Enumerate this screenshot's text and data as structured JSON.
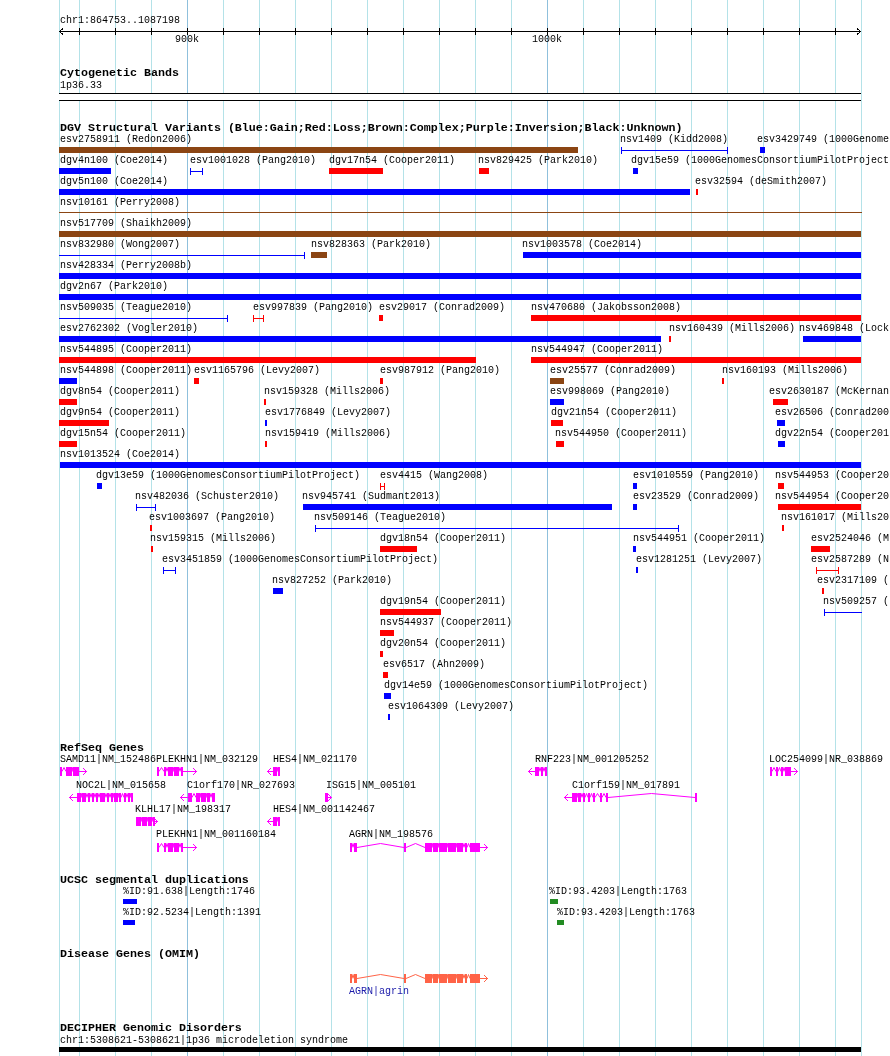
{
  "ruler": {
    "region": "chr1:864753..1087198",
    "ticks": [
      "900k",
      "1000k"
    ]
  },
  "cytogenetic_bands": {
    "title": "Cytogenetic Bands",
    "band": "1p36.33"
  },
  "dgv_variants": {
    "title": "DGV Structural Variants (Blue:Gain;Red:Loss;Brown:Complex;Purple:Inversion;Black:Unknown)",
    "features": [
      {
        "label": "esv2758911 (Redon2006)",
        "kind": "bar",
        "color": "#8b4513"
      },
      {
        "label": "nsv1409 (Kidd2008)",
        "kind": "span",
        "color": "#0000ff"
      },
      {
        "label": "esv3429749 (1000Genome",
        "kind": "bar",
        "color": "#0000ff"
      },
      {
        "label": "dgv4n100 (Coe2014)",
        "kind": "bar",
        "color": "#0000ff"
      },
      {
        "label": "esv1001028 (Pang2010)",
        "kind": "span",
        "color": "#0000ff"
      },
      {
        "label": "dgv17n54 (Cooper2011)",
        "kind": "bar",
        "color": "#ff0000"
      },
      {
        "label": "nsv829425 (Park2010)",
        "kind": "bar",
        "color": "#ff0000"
      },
      {
        "label": "dgv15e59 (1000GenomesConsortiumPilotProject",
        "kind": "bar",
        "color": "#0000ff"
      },
      {
        "label": "dgv5n100 (Coe2014)",
        "kind": "bar",
        "color": "#0000ff"
      },
      {
        "label": "esv32594 (deSmith2007)",
        "kind": "bar",
        "color": "#ff0000"
      },
      {
        "label": "nsv10161 (Perry2008)",
        "kind": "span",
        "color": "#8b4513"
      },
      {
        "label": "nsv517709 (Shaikh2009)",
        "kind": "bar",
        "color": "#8b4513"
      },
      {
        "label": "nsv832980 (Wong2007)",
        "kind": "span",
        "color": "#0000ff"
      },
      {
        "label": "nsv828363 (Park2010)",
        "kind": "bar",
        "color": "#8b4513"
      },
      {
        "label": "nsv1003578 (Coe2014)",
        "kind": "bar",
        "color": "#0000ff"
      },
      {
        "label": "nsv428334 (Perry2008b)",
        "kind": "bar",
        "color": "#0000ff"
      },
      {
        "label": "dgv2n67 (Park2010)",
        "kind": "bar",
        "color": "#0000ff"
      },
      {
        "label": "nsv509035 (Teague2010)",
        "kind": "span",
        "color": "#0000ff"
      },
      {
        "label": "esv997839 (Pang2010)",
        "kind": "span",
        "color": "#ff0000"
      },
      {
        "label": "esv29017 (Conrad2009)",
        "kind": "bar",
        "color": "#ff0000"
      },
      {
        "label": "nsv470680 (Jakobsson2008)",
        "kind": "bar",
        "color": "#ff0000"
      },
      {
        "label": "esv2762302 (Vogler2010)",
        "kind": "bar",
        "color": "#0000ff"
      },
      {
        "label": "nsv160439 (Mills2006)",
        "kind": "bar",
        "color": "#ff0000"
      },
      {
        "label": "nsv469848 (Lock",
        "kind": "bar",
        "color": "#0000ff"
      },
      {
        "label": "nsv544895 (Cooper2011)",
        "kind": "bar",
        "color": "#ff0000"
      },
      {
        "label": "nsv544947 (Cooper2011)",
        "kind": "bar",
        "color": "#ff0000"
      },
      {
        "label": "nsv544898 (Cooper2011)",
        "kind": "bar",
        "color": "#0000ff"
      },
      {
        "label": "esv1165796 (Levy2007)",
        "kind": "bar",
        "color": "#ff0000"
      },
      {
        "label": "esv987912 (Pang2010)",
        "kind": "bar",
        "color": "#ff0000"
      },
      {
        "label": "esv25577 (Conrad2009)",
        "kind": "bar",
        "color": "#8b4513"
      },
      {
        "label": "nsv160193 (Mills2006)",
        "kind": "bar",
        "color": "#ff0000"
      },
      {
        "label": "dgv8n54 (Cooper2011)",
        "kind": "bar",
        "color": "#ff0000"
      },
      {
        "label": "nsv159328 (Mills2006)",
        "kind": "bar",
        "color": "#ff0000"
      },
      {
        "label": "esv998069 (Pang2010)",
        "kind": "bar",
        "color": "#0000ff"
      },
      {
        "label": "esv2630187 (McKernan",
        "kind": "bar",
        "color": "#ff0000"
      },
      {
        "label": "dgv9n54 (Cooper2011)",
        "kind": "bar",
        "color": "#ff0000"
      },
      {
        "label": "esv1776849 (Levy2007)",
        "kind": "bar",
        "color": "#0000ff"
      },
      {
        "label": "dgv21n54 (Cooper2011)",
        "kind": "bar",
        "color": "#ff0000"
      },
      {
        "label": "esv26506 (Conrad200",
        "kind": "bar",
        "color": "#0000ff"
      },
      {
        "label": "dgv15n54 (Cooper2011)",
        "kind": "bar",
        "color": "#ff0000"
      },
      {
        "label": "nsv159419 (Mills2006)",
        "kind": "bar",
        "color": "#ff0000"
      },
      {
        "label": "nsv544950 (Cooper2011)",
        "kind": "bar",
        "color": "#ff0000"
      },
      {
        "label": "dgv22n54 (Cooper201",
        "kind": "bar",
        "color": "#0000ff"
      },
      {
        "label": "nsv1013524 (Coe2014)",
        "kind": "bar",
        "color": "#0000ff"
      },
      {
        "label": "dgv13e59 (1000GenomesConsortiumPilotProject)",
        "kind": "bar",
        "color": "#0000ff"
      },
      {
        "label": "esv4415 (Wang2008)",
        "kind": "span",
        "color": "#ff0000"
      },
      {
        "label": "esv1010559 (Pang2010)",
        "kind": "bar",
        "color": "#0000ff"
      },
      {
        "label": "nsv544953 (Cooper20",
        "kind": "bar",
        "color": "#ff0000"
      },
      {
        "label": "nsv482036 (Schuster2010)",
        "kind": "span",
        "color": "#0000ff"
      },
      {
        "label": "nsv945741 (Sudmant2013)",
        "kind": "bar",
        "color": "#0000ff"
      },
      {
        "label": "esv23529 (Conrad2009)",
        "kind": "bar",
        "color": "#0000ff"
      },
      {
        "label": "nsv544954 (Cooper20",
        "kind": "bar",
        "color": "#ff0000"
      },
      {
        "label": "esv1003697 (Pang2010)",
        "kind": "bar",
        "color": "#ff0000"
      },
      {
        "label": "nsv509146 (Teague2010)",
        "kind": "span",
        "color": "#0000ff"
      },
      {
        "label": "nsv161017 (Mills20",
        "kind": "bar",
        "color": "#ff0000"
      },
      {
        "label": "nsv159315 (Mills2006)",
        "kind": "bar",
        "color": "#ff0000"
      },
      {
        "label": "dgv18n54 (Cooper2011)",
        "kind": "bar",
        "color": "#ff0000"
      },
      {
        "label": "nsv544951 (Cooper2011)",
        "kind": "bar",
        "color": "#0000ff"
      },
      {
        "label": "esv2524046 (M",
        "kind": "bar",
        "color": "#ff0000"
      },
      {
        "label": "esv3451859 (1000GenomesConsortiumPilotProject)",
        "kind": "span",
        "color": "#0000ff"
      },
      {
        "label": "esv1281251 (Levy2007)",
        "kind": "bar",
        "color": "#0000ff"
      },
      {
        "label": "esv2587289 (N",
        "kind": "span",
        "color": "#ff0000"
      },
      {
        "label": "nsv827252 (Park2010)",
        "kind": "bar",
        "color": "#0000ff"
      },
      {
        "label": "esv2317109 (",
        "kind": "bar",
        "color": "#ff0000"
      },
      {
        "label": "dgv19n54 (Cooper2011)",
        "kind": "bar",
        "color": "#ff0000"
      },
      {
        "label": "nsv509257 (",
        "kind": "span",
        "color": "#0000ff"
      },
      {
        "label": "nsv544937 (Cooper2011)",
        "kind": "bar",
        "color": "#ff0000"
      },
      {
        "label": "dgv20n54 (Cooper2011)",
        "kind": "bar",
        "color": "#ff0000"
      },
      {
        "label": "esv6517 (Ahn2009)",
        "kind": "bar",
        "color": "#ff0000"
      },
      {
        "label": "dgv14e59 (1000GenomesConsortiumPilotProject)",
        "kind": "bar",
        "color": "#0000ff"
      },
      {
        "label": "esv1064309 (Levy2007)",
        "kind": "bar",
        "color": "#0000ff"
      }
    ]
  },
  "refseq_genes": {
    "title": "RefSeq Genes",
    "genes": [
      {
        "label": "SAMD11|NM_152486",
        "reverse_strand": false
      },
      {
        "label": "PLEKHN1|NM_032129",
        "reverse_strand": false
      },
      {
        "label": "HES4|NM_021170",
        "reverse_strand": true
      },
      {
        "label": "RNF223|NM_001205252",
        "reverse_strand": true
      },
      {
        "label": "LOC254099|NR_038869",
        "reverse_strand": false
      },
      {
        "label": "NOC2L|NM_015658",
        "reverse_strand": true
      },
      {
        "label": "C1orf170|NR_027693",
        "reverse_strand": true
      },
      {
        "label": "ISG15|NM_005101",
        "reverse_strand": false
      },
      {
        "label": "C1orf159|NM_017891",
        "reverse_strand": true
      },
      {
        "label": "KLHL17|NM_198317",
        "reverse_strand": false
      },
      {
        "label": "HES4|NM_001142467",
        "reverse_strand": true
      },
      {
        "label": "PLEKHN1|NM_001160184",
        "reverse_strand": false
      },
      {
        "label": "AGRN|NM_198576",
        "reverse_strand": false
      }
    ]
  },
  "segmental_duplications": {
    "title": "UCSC segmental duplications",
    "features": [
      {
        "label": "%ID:91.638|Length:1746",
        "color": "#0000ff"
      },
      {
        "label": "%ID:93.4203|Length:1763",
        "color": "#228b22"
      },
      {
        "label": "%ID:92.5234|Length:1391",
        "color": "#0000ff"
      },
      {
        "label": "%ID:93.4203|Length:1763",
        "color": "#228b22"
      }
    ]
  },
  "disease_genes": {
    "title": "Disease Genes (OMIM)",
    "genes": [
      {
        "label": "AGRN|agrin",
        "reverse_strand": false
      }
    ]
  },
  "decipher": {
    "title": "DECIPHER Genomic Disorders",
    "features": [
      {
        "label": "chr1:5308621-5308621|1p36 microdeletion syndrome"
      }
    ]
  }
}
